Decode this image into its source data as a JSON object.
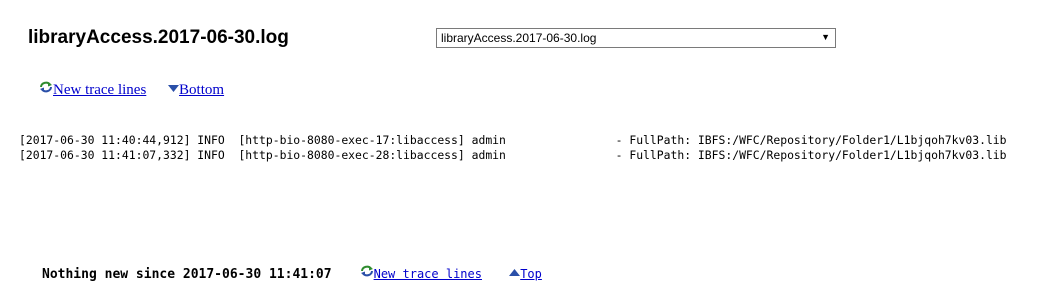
{
  "page": {
    "title": "libraryAccess.2017-06-30.log"
  },
  "file_select": {
    "selected": "libraryAccess.2017-06-30.log"
  },
  "toplinks": {
    "new_trace": "New trace lines",
    "bottom": "Bottom"
  },
  "log_lines": [
    "[2017-06-30 11:40:44,912] INFO  [http-bio-8080-exec-17:libaccess] admin                - FullPath: IBFS:/WFC/Repository/Folder1/L1bjqoh7kv03.lib",
    "[2017-06-30 11:41:07,332] INFO  [http-bio-8080-exec-28:libaccess] admin                - FullPath: IBFS:/WFC/Repository/Folder1/L1bjqoh7kv03.lib"
  ],
  "footer": {
    "status": "Nothing new since 2017-06-30 11:41:07",
    "new_trace": "New trace lines",
    "top": "Top"
  },
  "colors": {
    "link": "#0000cc",
    "icon_green": "#2e8b2e",
    "icon_blue": "#2a4fa8"
  },
  "icons": {
    "refresh": "refresh-icon",
    "down": "triangle-down-icon",
    "up": "triangle-up-icon"
  }
}
